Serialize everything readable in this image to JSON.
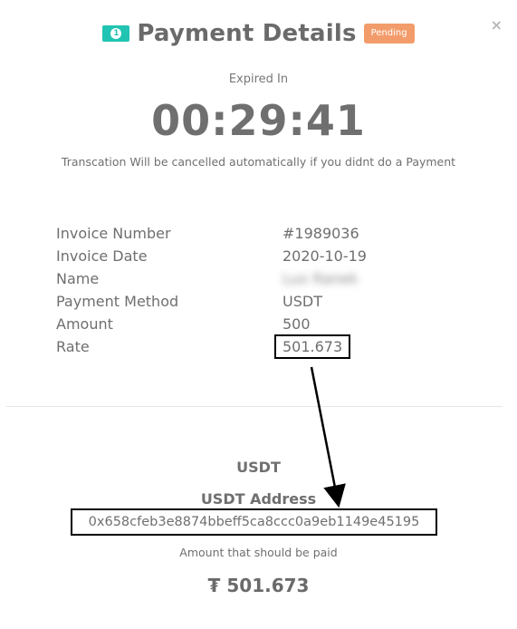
{
  "header": {
    "icon": "money-bill-icon",
    "icon_glyph": "1",
    "title": "Payment Details",
    "status_badge": "Pending",
    "close_glyph": "×"
  },
  "timer": {
    "label": "Expired In",
    "value": "00:29:41",
    "warning": "Transcation Will be cancelled automatically if you didnt do a Payment"
  },
  "details": [
    {
      "label": "Invoice Number",
      "value": "#1989036"
    },
    {
      "label": "Invoice Date",
      "value": "2020-10-19"
    },
    {
      "label": "Name",
      "value": "Lux Ranek"
    },
    {
      "label": "Payment Method",
      "value": "USDT"
    },
    {
      "label": "Amount",
      "value": "500"
    },
    {
      "label": "Rate",
      "value": "501.673"
    }
  ],
  "payment": {
    "currency": "USDT",
    "address_label": "USDT Address",
    "address": "0x658cfeb3e8874bbeff5ca8ccc0a9eb1149e45195",
    "amount_label": "Amount that should be paid",
    "amount": "₮ 501.673"
  },
  "colors": {
    "accent": "#21c4b2",
    "badge": "#f39c6b",
    "text": "#6f6f6f"
  }
}
